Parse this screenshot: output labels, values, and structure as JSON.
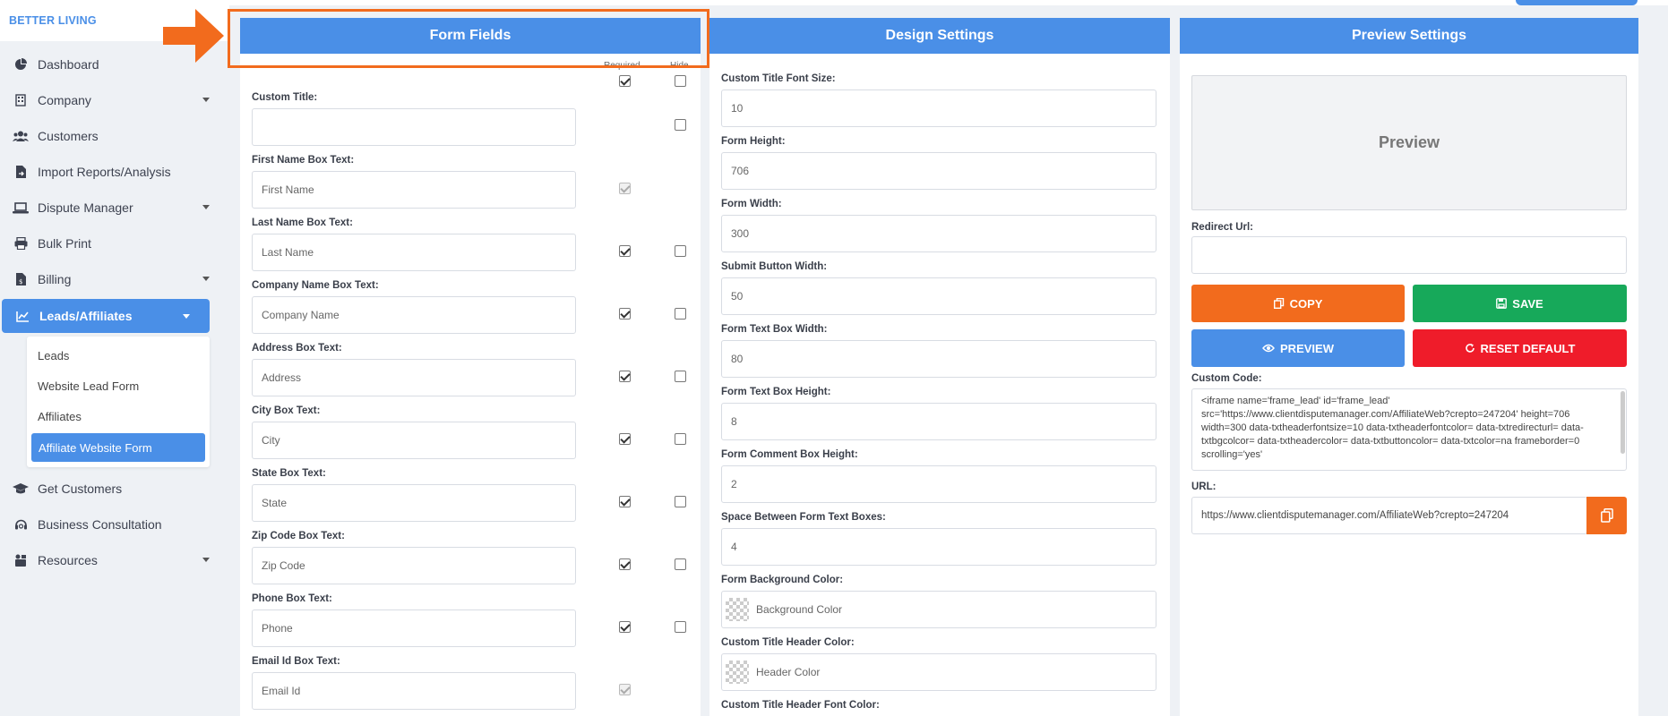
{
  "brand": "BETTER LIVING",
  "sidebar": {
    "items": [
      {
        "label": "Dashboard",
        "icon": "pie-chart-icon",
        "caret": false
      },
      {
        "label": "Company",
        "icon": "building-icon",
        "caret": true
      },
      {
        "label": "Customers",
        "icon": "users-icon",
        "caret": false
      },
      {
        "label": "Import Reports/Analysis",
        "icon": "file-import-icon",
        "caret": false
      },
      {
        "label": "Dispute Manager",
        "icon": "laptop-icon",
        "caret": true
      },
      {
        "label": "Bulk Print",
        "icon": "printer-icon",
        "caret": false
      },
      {
        "label": "Billing",
        "icon": "billing-icon",
        "caret": true
      },
      {
        "label": "Leads/Affiliates",
        "icon": "chart-line-icon",
        "caret": true,
        "active": true
      }
    ],
    "submenu": [
      "Leads",
      "Website Lead Form",
      "Affiliates",
      "Affiliate Website Form"
    ],
    "items_after": [
      {
        "label": "Get Customers",
        "icon": "graduation-cap-icon",
        "caret": false
      },
      {
        "label": "Business Consultation",
        "icon": "headset-icon",
        "caret": false
      },
      {
        "label": "Resources",
        "icon": "resources-icon",
        "caret": true
      }
    ]
  },
  "form_fields": {
    "title": "Form Fields",
    "col_required": "Required",
    "col_hide": "Hide",
    "fields": [
      {
        "label": "Custom Title:",
        "value": "",
        "placeholder": "",
        "required": "on",
        "hide": "off"
      },
      {
        "label": "First Name Box Text:",
        "value": "",
        "placeholder": "First Name",
        "required": "disabled",
        "hide": "none"
      },
      {
        "label": "Last Name Box Text:",
        "value": "",
        "placeholder": "Last Name",
        "required": "on",
        "hide": "off"
      },
      {
        "label": "Company Name Box Text:",
        "value": "",
        "placeholder": "Company Name",
        "required": "on",
        "hide": "off"
      },
      {
        "label": "Address Box Text:",
        "value": "",
        "placeholder": "Address",
        "required": "on",
        "hide": "off"
      },
      {
        "label": "City Box Text:",
        "value": "",
        "placeholder": "City",
        "required": "on",
        "hide": "off"
      },
      {
        "label": "State Box Text:",
        "value": "",
        "placeholder": "State",
        "required": "on",
        "hide": "off"
      },
      {
        "label": "Zip Code Box Text:",
        "value": "",
        "placeholder": "Zip Code",
        "required": "on",
        "hide": "off"
      },
      {
        "label": "Phone Box Text:",
        "value": "",
        "placeholder": "Phone",
        "required": "on",
        "hide": "off"
      },
      {
        "label": "Email Id Box Text:",
        "value": "",
        "placeholder": "Email Id",
        "required": "disabled",
        "hide": "none"
      }
    ]
  },
  "design_settings": {
    "title": "Design Settings",
    "fields": [
      {
        "label": "Custom Title Font Size:",
        "value": "10"
      },
      {
        "label": "Form Height:",
        "value": "706"
      },
      {
        "label": "Form Width:",
        "value": "300"
      },
      {
        "label": "Submit Button Width:",
        "value": "50"
      },
      {
        "label": "Form Text Box Width:",
        "value": "80"
      },
      {
        "label": "Form Text Box Height:",
        "value": "8"
      },
      {
        "label": "Form Comment Box Height:",
        "value": "2"
      },
      {
        "label": "Space Between Form Text Boxes:",
        "value": "4"
      },
      {
        "label": "Form Background Color:",
        "value": "Background Color",
        "swatch": true
      },
      {
        "label": "Custom Title Header Color:",
        "value": "Header Color",
        "swatch": true
      },
      {
        "label": "Custom Title Header Font Color:",
        "value": "",
        "swatch": false
      }
    ]
  },
  "preview_settings": {
    "title": "Preview Settings",
    "preview_label": "Preview",
    "redirect_label": "Redirect Url:",
    "redirect_value": "",
    "buttons": {
      "copy": "COPY",
      "save": "SAVE",
      "preview": "PREVIEW",
      "reset": "RESET DEFAULT"
    },
    "custom_code_label": "Custom Code:",
    "custom_code": "<iframe name='frame_lead' id='frame_lead' src='https://www.clientdisputemanager.com/AffiliateWeb?crepto=247204' height=706 width=300 data-txtheaderfontsize=10 data-txtheaderfontcolor= data-txtredirecturl= data-txtbgcolcor= data-txtheadercolor= data-txtbuttoncolor= data-txtcolor=na frameborder=0  scrolling='yes'",
    "url_label": "URL:",
    "url_value": "https://www.clientdisputemanager.com/AffiliateWeb?crepto=247204"
  },
  "colors": {
    "primary": "#4a8fe7",
    "orange": "#f26b1d",
    "green": "#17a95a",
    "red": "#ef1c2a"
  }
}
